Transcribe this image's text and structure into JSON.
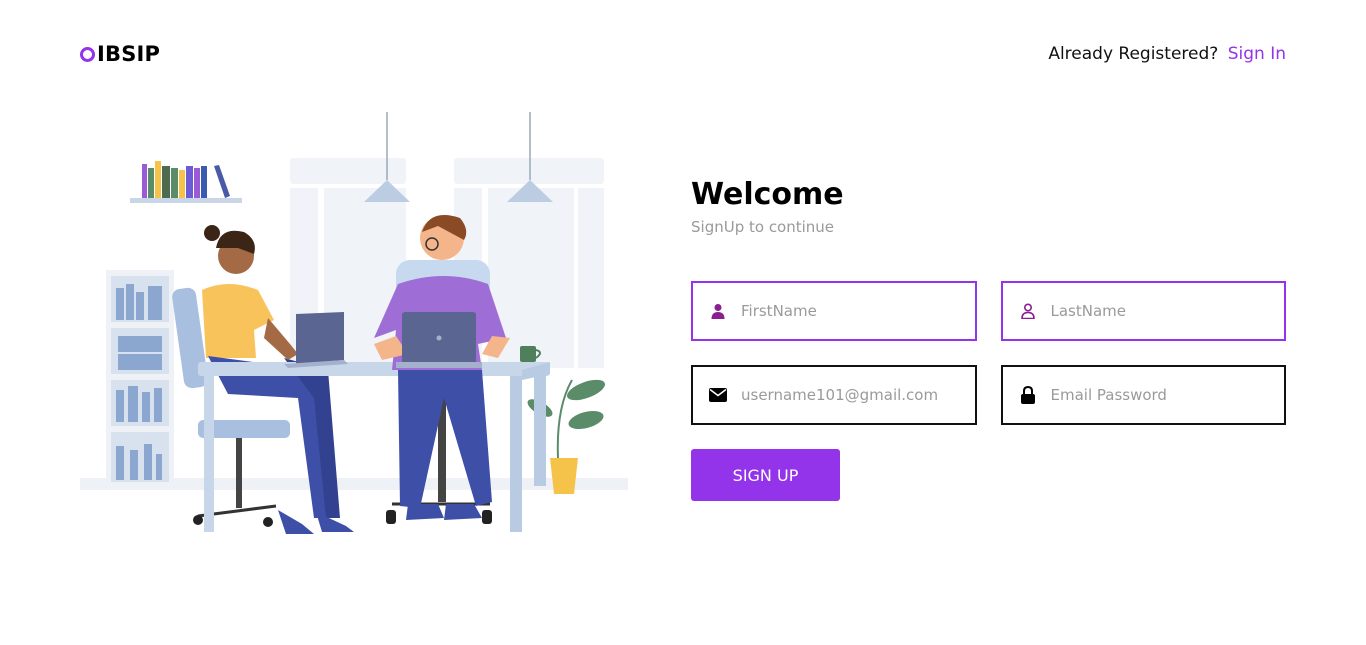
{
  "header": {
    "logo_text": "IBSIP",
    "already_text": "Already Registered?",
    "signin_label": "Sign In"
  },
  "form": {
    "title": "Welcome",
    "subtitle": "SignUp to continue",
    "first_name_placeholder": "FirstName",
    "last_name_placeholder": "LastName",
    "email_placeholder": "username101@gmail.com",
    "password_placeholder": "Email Password",
    "signup_label": "SIGN UP"
  },
  "colors": {
    "accent": "#9333ea",
    "placeholder": "#9a9a9a"
  },
  "icons": {
    "first_name": "user-filled-icon",
    "last_name": "user-outline-icon",
    "email": "envelope-icon",
    "password": "lock-icon"
  }
}
